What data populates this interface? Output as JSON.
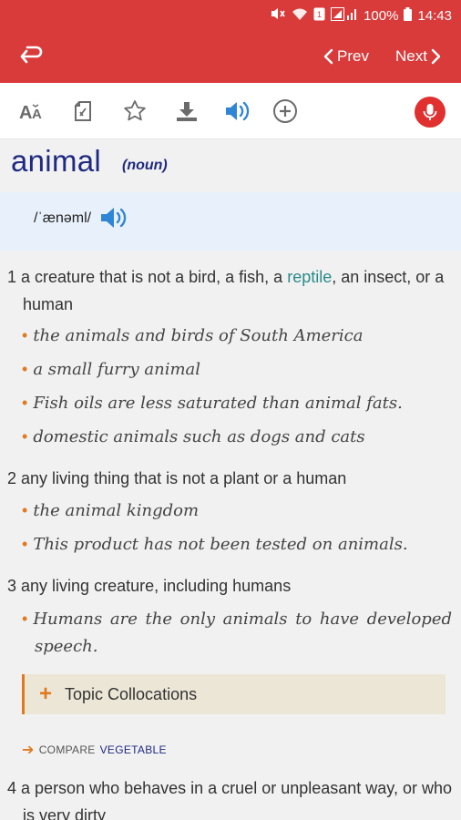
{
  "status_bar": {
    "battery": "100%",
    "time": "14:43"
  },
  "app_bar": {
    "prev_label": "Prev",
    "next_label": "Next"
  },
  "toolbar": {
    "icons": [
      "font-size-icon",
      "flashcard-icon",
      "star-icon",
      "download-icon",
      "speaker-icon",
      "add-circle-icon",
      "mic-icon"
    ],
    "accent_color": "#d93b3b",
    "audio_color": "#2f86d6"
  },
  "entry": {
    "headword": "animal",
    "part_of_speech": "(noun)",
    "pronunciation": "/ˈænəml/",
    "senses": [
      {
        "number": "1",
        "definition_before": "a creature that is not a bird, a fish, a ",
        "definition_link": "reptile",
        "definition_after": ", an insect, or a human",
        "examples": [
          "the animals and birds of South America",
          "a small furry animal",
          "Fish oils are less saturated than animal fats.",
          "domestic animals such as dogs and cats"
        ]
      },
      {
        "number": "2",
        "definition": "any living thing that is not a plant or a human",
        "examples": [
          "the animal kingdom",
          "This product has not been tested on animals."
        ]
      },
      {
        "number": "3",
        "definition": "any living creature, including humans",
        "examples": [
          "Humans are the only animals to have developed speech."
        ]
      },
      {
        "number": "4",
        "definition": "a person who behaves in a cruel or unpleasant way, or who is very dirty"
      }
    ],
    "topic_collocations_label": "Topic Collocations",
    "compare": {
      "label": "COMPARE",
      "word": "VEGETABLE"
    }
  }
}
